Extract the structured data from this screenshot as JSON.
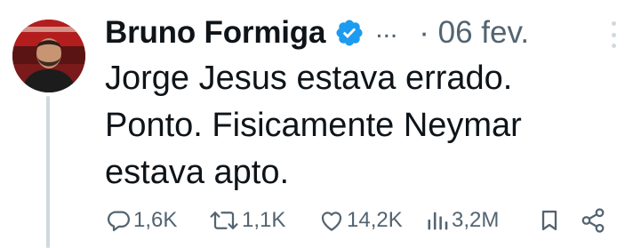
{
  "author": {
    "name": "Bruno Formiga",
    "verified": true,
    "verified_color": "#1d9bf0"
  },
  "header": {
    "ellipsis": "...",
    "date": "· 06 fev.",
    "more_icon": "more-vertical-icon"
  },
  "tweet": {
    "lines": [
      "Jorge Jesus estava errado.",
      "Ponto. Fisicamente Neymar",
      "estava apto."
    ]
  },
  "actions": {
    "replies": "1,6K",
    "retweets": "1,1K",
    "likes": "14,2K",
    "views": "3,2M",
    "icons": [
      "reply-icon",
      "retweet-icon",
      "like-icon",
      "views-icon",
      "bookmark-icon",
      "share-icon"
    ]
  },
  "colors": {
    "text": "#0f1419",
    "secondary": "#536471",
    "thread_line": "#cfd9de"
  }
}
